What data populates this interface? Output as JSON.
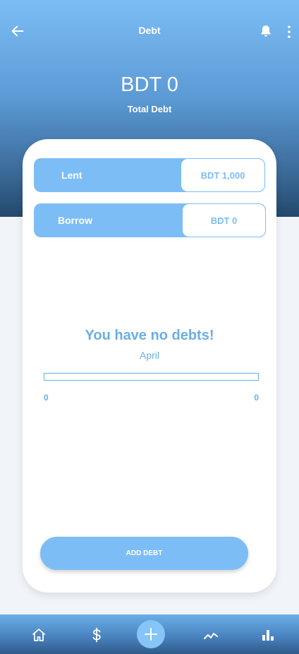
{
  "header": {
    "title": "Debt",
    "total_amount": "BDT 0",
    "total_label": "Total Debt"
  },
  "summary": {
    "lent": {
      "label": "Lent",
      "value": "BDT 1,000"
    },
    "borrow": {
      "label": "Borrow",
      "value": "BDT 0"
    }
  },
  "empty_state": {
    "message": "You have no debts!",
    "month": "April",
    "progress_fraction": 0,
    "progress_start": "0",
    "progress_end": "0"
  },
  "actions": {
    "add_debt_label": "ADD DEBT"
  },
  "icons": {
    "back": "arrow-left-icon",
    "bell": "bell-icon",
    "more": "more-vertical-icon",
    "home": "home-icon",
    "money": "dollar-icon",
    "add": "plus-icon",
    "trend": "trend-line-icon",
    "stats": "bar-chart-icon"
  },
  "colors": {
    "accent": "#7dbdf5",
    "text_accent": "#6aaee6",
    "header_top": "#7dbdf5",
    "header_bottom": "#24486d",
    "background": "#f1f5fa"
  }
}
